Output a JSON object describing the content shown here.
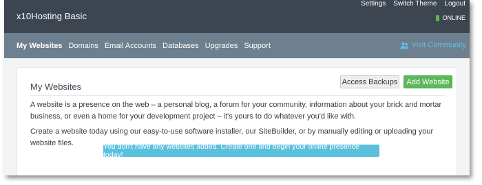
{
  "header": {
    "brand": "x10Hosting Basic",
    "links": [
      "Settings",
      "Switch Theme",
      "Logout"
    ],
    "status": "ONLINE",
    "status_color": "#5cb85c"
  },
  "nav": {
    "items": [
      "My Websites",
      "Domains",
      "Email Accounts",
      "Databases",
      "Upgrades",
      "Support"
    ],
    "active": "My Websites",
    "community": "Visit Community",
    "community_icon": "users-icon"
  },
  "panel": {
    "title": "My Websites",
    "backups_label": "Access Backups",
    "add_label": "Add Website",
    "description": "A website is a presence on the web – a personal blog, a forum for your community, information about your brick and mortar business, or even a home for your development project – it's yours to do whatever you'd like with.",
    "instructions": "Create a website today using our easy-to-use software installer, our SiteBuilder, or by manually editing or uploading your website files.",
    "notice": "You don't have any websites added. Create one and begin your online presence today!"
  },
  "colors": {
    "topbar": "#3c4550",
    "navbar": "#6e7f8f",
    "add_button": "#5cb85c",
    "notice": "#5bc0de"
  }
}
